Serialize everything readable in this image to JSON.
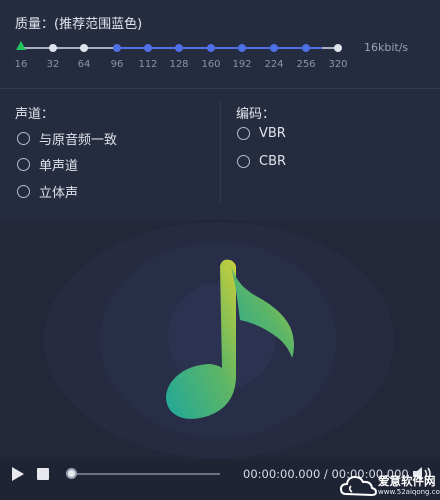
{
  "quality": {
    "title": "质量：(推荐范围蓝色)",
    "bitrate_display": "16kbit/s",
    "selected_value": 16,
    "ticks": [
      "16",
      "32",
      "64",
      "96",
      "112",
      "128",
      "160",
      "192",
      "224",
      "256",
      "320"
    ],
    "recommended_range": [
      "96",
      "256"
    ],
    "colors": {
      "recommended": "#4f6fe6",
      "normal": "#dfe3ea",
      "handle": "#22c55e"
    }
  },
  "channel": {
    "label": "声道：",
    "options": [
      "与原音频一致",
      "单声道",
      "立体声"
    ]
  },
  "encoding": {
    "label": "编码：",
    "options": [
      "VBR",
      "CBR"
    ]
  },
  "preview": {
    "icon": "music-note-icon"
  },
  "player": {
    "play_icon": "play-icon",
    "stop_icon": "stop-icon",
    "progress": 0,
    "current_time": "00:00:00.000",
    "total_time": "00:00:00.000",
    "time_separator": " / ",
    "volume_icon": "volume-icon"
  },
  "watermark": {
    "text": "爱意软件网",
    "url": "www.52aiqong.com"
  }
}
